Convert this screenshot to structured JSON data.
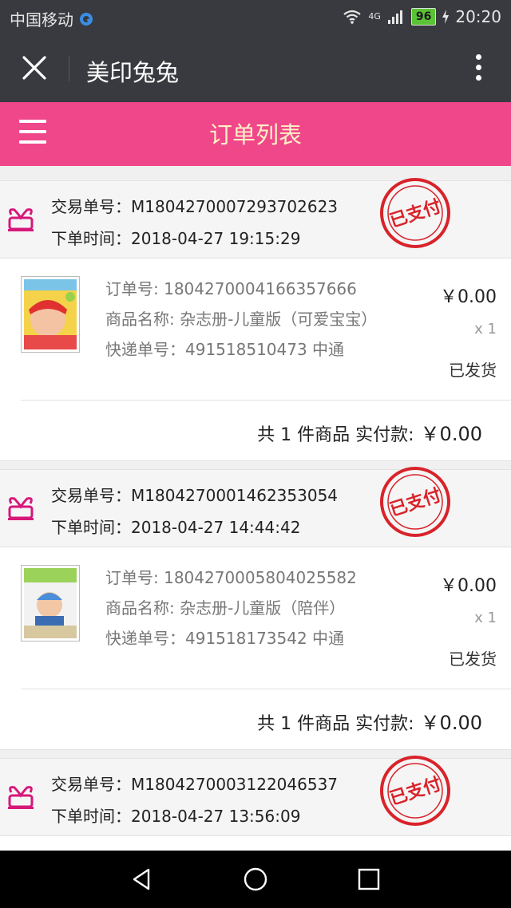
{
  "status_bar": {
    "carrier": "中国移动",
    "network": "4G",
    "battery": "96",
    "time": "20:20"
  },
  "app_bar": {
    "title": "美印兔兔"
  },
  "header": {
    "title": "订单列表"
  },
  "orders": [
    {
      "trade_no_label": "交易单号：",
      "trade_no": "M1804270007293702623",
      "time_label": "下单时间：",
      "time": "2018-04-27 19:15:29",
      "stamp": "已支付",
      "item": {
        "order_no": "订单号: 1804270004166357666",
        "name": "商品名称: 杂志册-儿童版（可爱宝宝）",
        "express": "快递单号：491518510473 中通",
        "price": "￥0.00",
        "qty": "x 1",
        "status": "已发货"
      },
      "summary_text": "共 1 件商品 实付款:",
      "summary_amount": "￥0.00"
    },
    {
      "trade_no_label": "交易单号：",
      "trade_no": "M1804270001462353054",
      "time_label": "下单时间：",
      "time": "2018-04-27 14:44:42",
      "stamp": "已支付",
      "item": {
        "order_no": "订单号: 1804270005804025582",
        "name": "商品名称: 杂志册-儿童版（陪伴）",
        "express": "快递单号：491518173542 中通",
        "price": "￥0.00",
        "qty": "x 1",
        "status": "已发货"
      },
      "summary_text": "共 1 件商品 实付款:",
      "summary_amount": "￥0.00"
    },
    {
      "trade_no_label": "交易单号：",
      "trade_no": "M1804270003122046537",
      "time_label": "下单时间：",
      "time": "2018-04-27 13:56:09",
      "stamp": "已支付"
    }
  ],
  "colors": {
    "app_bar": "#393a3f",
    "header": "#f0478b",
    "header_title": "#fff2c5",
    "stamp": "#d8232a",
    "store_icon": "#d6177a"
  }
}
